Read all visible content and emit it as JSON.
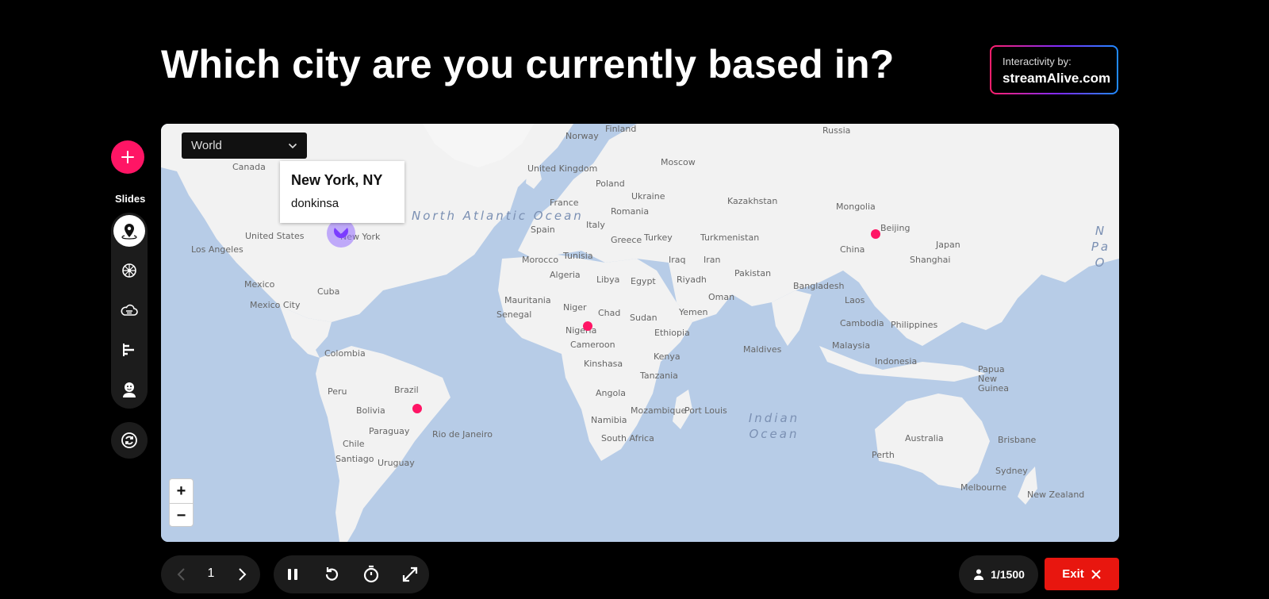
{
  "question": "Which city are you currently based in?",
  "branding": {
    "top": "Interactivity by:",
    "name": "streamAlive.com"
  },
  "sidebar": {
    "add_icon": "plus-icon",
    "slides_label": "Slides",
    "items": [
      {
        "icon": "map-pin-icon",
        "active": true
      },
      {
        "icon": "wheel-icon",
        "active": false
      },
      {
        "icon": "word-cloud-icon",
        "active": false
      },
      {
        "icon": "bar-chart-icon",
        "active": false
      },
      {
        "icon": "avatar-icon",
        "active": false
      }
    ],
    "sync_icon": "sync-icon"
  },
  "map": {
    "region_select": "World",
    "tooltip": {
      "city": "New York, NY",
      "user": "donkinsa"
    },
    "zoom_in": "+",
    "zoom_out": "−",
    "oceans": {
      "north_atlantic": "North Atlantic Ocean",
      "indian": "Indian Ocean",
      "pacific": "N Pa O"
    },
    "labels": {
      "canada": "Canada",
      "united_states": "United States",
      "los_angeles": "Los Angeles",
      "new_york": "New York",
      "mexico": "Mexico",
      "mexico_city": "Mexico City",
      "cuba": "Cuba",
      "colombia": "Colombia",
      "peru": "Peru",
      "brazil": "Brazil",
      "bolivia": "Bolivia",
      "paraguay": "Paraguay",
      "chile": "Chile",
      "santiago": "Santiago",
      "uruguay": "Uruguay",
      "rio": "Rio de Janeiro",
      "norway": "Norway",
      "finland": "Finland",
      "russia": "Russia",
      "uk": "United Kingdom",
      "poland": "Poland",
      "ukraine": "Ukraine",
      "moscow": "Moscow",
      "france": "France",
      "italy": "Italy",
      "romania": "Romania",
      "spain": "Spain",
      "greece": "Greece",
      "turkey": "Turkey",
      "kazakhstan": "Kazakhstan",
      "mongolia": "Mongolia",
      "turkmenistan": "Turkmenistan",
      "beijing": "Beijing",
      "china": "China",
      "shanghai": "Shanghai",
      "japan": "Japan",
      "morocco": "Morocco",
      "tunisia": "Tunisia",
      "algeria": "Algeria",
      "libya": "Libya",
      "egypt": "Egypt",
      "iraq": "Iraq",
      "iran": "Iran",
      "riyadh": "Riyadh",
      "pakistan": "Pakistan",
      "oman": "Oman",
      "bangladesh": "Bangladesh",
      "laos": "Laos",
      "mauritania": "Mauritania",
      "niger": "Niger",
      "chad": "Chad",
      "sudan": "Sudan",
      "senegal": "Senegal",
      "nigeria": "Nigeria",
      "ethiopia": "Ethiopia",
      "yemen": "Yemen",
      "cambodia": "Cambodia",
      "philippines": "Philippines",
      "cameroon": "Cameroon",
      "kenya": "Kenya",
      "maldives": "Maldives",
      "malaysia": "Malaysia",
      "kinshasa": "Kinshasa",
      "tanzania": "Tanzania",
      "indonesia": "Indonesia",
      "papua": "Papua New Guinea",
      "angola": "Angola",
      "mozambique": "Mozambique",
      "port_louis": "Port Louis",
      "namibia": "Namibia",
      "south_africa": "South Africa",
      "australia": "Australia",
      "brisbane": "Brisbane",
      "perth": "Perth",
      "sydney": "Sydney",
      "melbourne": "Melbourne",
      "new_zealand": "New Zealand"
    }
  },
  "pager": {
    "current": "1"
  },
  "participants": "1/1500",
  "exit_label": "Exit",
  "colors": {
    "accent": "#ff1565",
    "exit": "#e8160f",
    "map_water": "#b7cce7",
    "map_land": "#f2f2f2"
  }
}
